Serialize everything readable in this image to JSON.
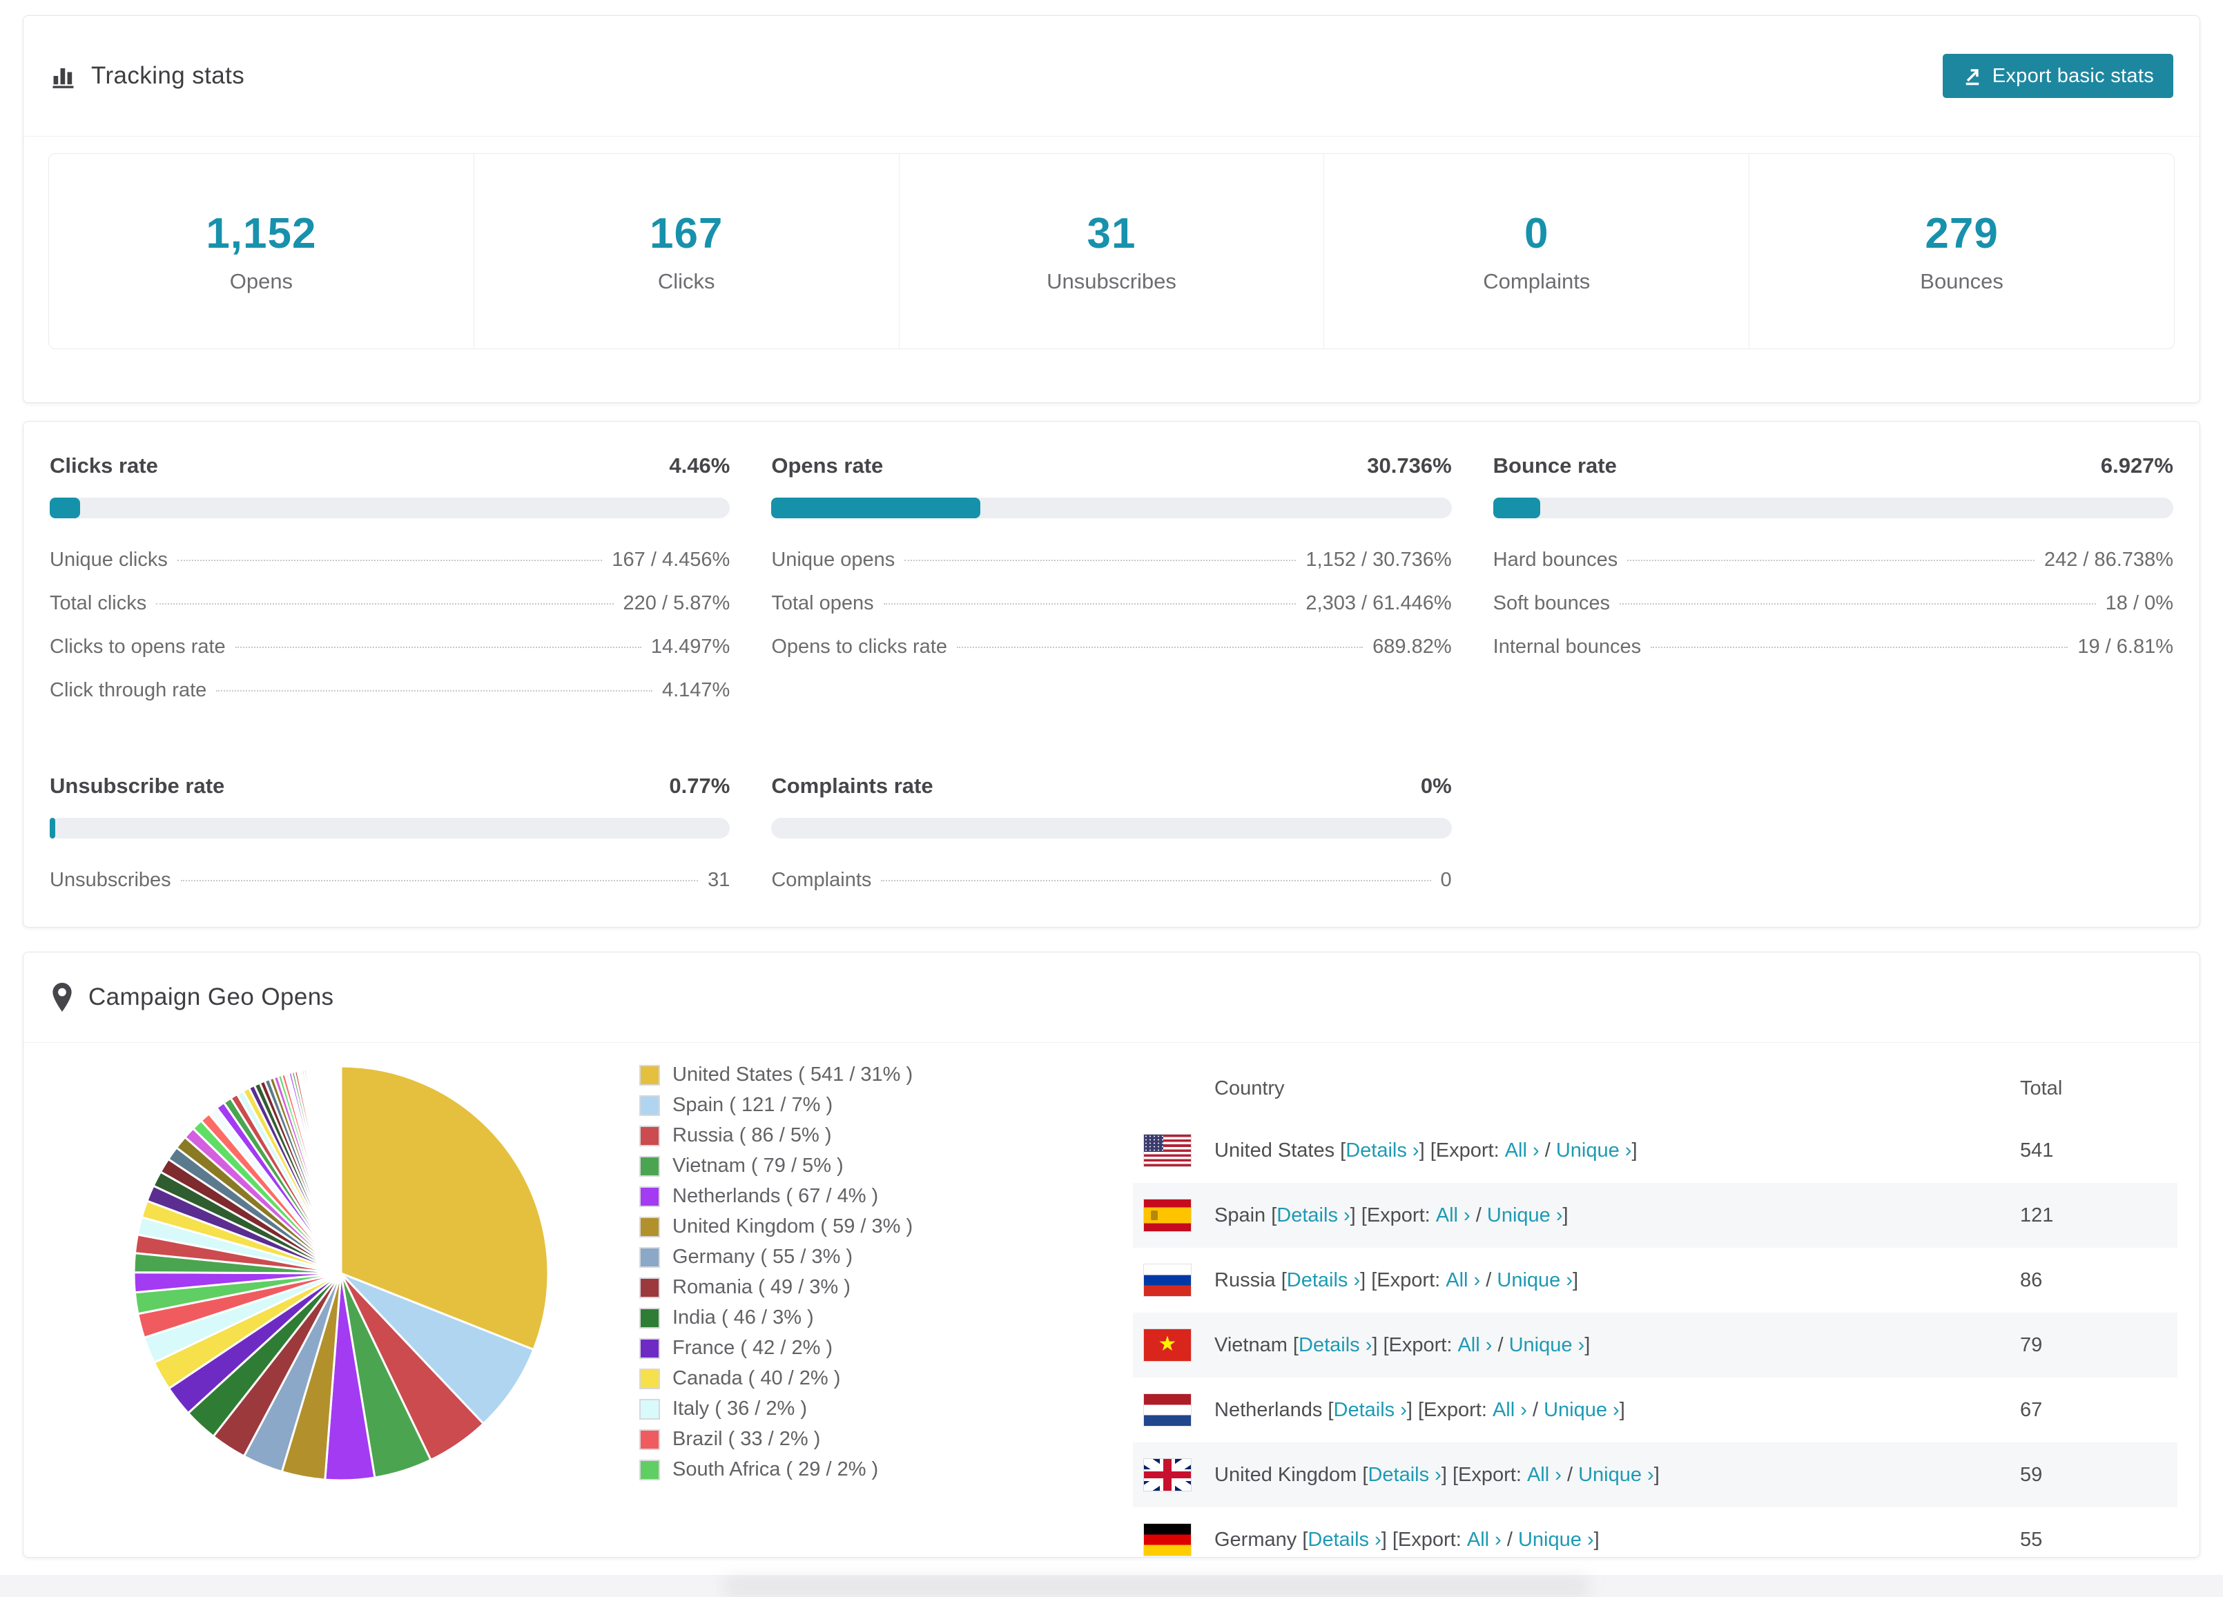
{
  "colors": {
    "accent_teal": "#1d87a0",
    "stat_teal": "#1791ac",
    "bar_fill": "#1592aa",
    "link_teal": "#1d9ab4",
    "bar_track": "#eceef2",
    "row_stripe": "#f6f7f8"
  },
  "tracking": {
    "title": "Tracking stats",
    "export_button": "Export basic stats",
    "stats": [
      {
        "value": "1,152",
        "label": "Opens"
      },
      {
        "value": "167",
        "label": "Clicks"
      },
      {
        "value": "31",
        "label": "Unsubscribes"
      },
      {
        "value": "0",
        "label": "Complaints"
      },
      {
        "value": "279",
        "label": "Bounces"
      }
    ]
  },
  "rates": [
    {
      "title": "Clicks rate",
      "percent": "4.46%",
      "bar_percent": 4.46,
      "rows": [
        {
          "label": "Unique clicks",
          "value": "167 / 4.456%"
        },
        {
          "label": "Total clicks",
          "value": "220 / 5.87%"
        },
        {
          "label": "Clicks to opens rate",
          "value": "14.497%"
        },
        {
          "label": "Click through rate",
          "value": "4.147%"
        }
      ]
    },
    {
      "title": "Opens rate",
      "percent": "30.736%",
      "bar_percent": 30.736,
      "rows": [
        {
          "label": "Unique opens",
          "value": "1,152 / 30.736%"
        },
        {
          "label": "Total opens",
          "value": "2,303 / 61.446%"
        },
        {
          "label": "Opens to clicks rate",
          "value": "689.82%"
        }
      ]
    },
    {
      "title": "Bounce rate",
      "percent": "6.927%",
      "bar_percent": 6.927,
      "rows": [
        {
          "label": "Hard bounces",
          "value": "242 / 86.738%"
        },
        {
          "label": "Soft bounces",
          "value": "18 / 0%"
        },
        {
          "label": "Internal bounces",
          "value": "19 / 6.81%"
        }
      ]
    },
    {
      "title": "Unsubscribe rate",
      "percent": "0.77%",
      "bar_percent": 0.77,
      "rows": [
        {
          "label": "Unsubscribes",
          "value": "31"
        }
      ]
    },
    {
      "title": "Complaints rate",
      "percent": "0%",
      "bar_percent": 0,
      "rows": [
        {
          "label": "Complaints",
          "value": "0"
        }
      ]
    }
  ],
  "geo": {
    "title": "Campaign Geo Opens",
    "links": {
      "open_bracket": " [",
      "details": "Details ›",
      "after_details": "] [Export: ",
      "all": "All ›",
      "slash": " / ",
      "unique": "Unique ›",
      "close_bracket": "]"
    },
    "table": {
      "columns": [
        "Country",
        "Total"
      ],
      "rows": [
        {
          "country": "United States",
          "flag": "us",
          "total": "541"
        },
        {
          "country": "Spain",
          "flag": "es",
          "total": "121"
        },
        {
          "country": "Russia",
          "flag": "ru",
          "total": "86"
        },
        {
          "country": "Vietnam",
          "flag": "vn",
          "total": "79"
        },
        {
          "country": "Netherlands",
          "flag": "nl",
          "total": "67"
        },
        {
          "country": "United Kingdom",
          "flag": "gb",
          "total": "59"
        },
        {
          "country": "Germany",
          "flag": "de",
          "total": "55"
        }
      ]
    }
  },
  "chart_data": {
    "type": "pie",
    "title": "Campaign Geo Opens",
    "unit": "opens",
    "start_angle_deg": -90,
    "direction": "clockwise",
    "legend_position": "right",
    "series": [
      {
        "name": "United States",
        "value": 541,
        "percent": "31%",
        "color": "#E5C03E",
        "legend_label": "United States ( 541 / 31% )"
      },
      {
        "name": "Spain",
        "value": 121,
        "percent": "7%",
        "color": "#AFD5F0",
        "legend_label": "Spain ( 121 / 7% )"
      },
      {
        "name": "Russia",
        "value": 86,
        "percent": "5%",
        "color": "#CB4B4F",
        "legend_label": "Russia ( 86 / 5% )"
      },
      {
        "name": "Vietnam",
        "value": 79,
        "percent": "5%",
        "color": "#4BA550",
        "legend_label": "Vietnam ( 79 / 5% )"
      },
      {
        "name": "Netherlands",
        "value": 67,
        "percent": "4%",
        "color": "#A23BF2",
        "legend_label": "Netherlands ( 67 / 4% )"
      },
      {
        "name": "United Kingdom",
        "value": 59,
        "percent": "3%",
        "color": "#B2912C",
        "legend_label": "United Kingdom ( 59 / 3% )"
      },
      {
        "name": "Germany",
        "value": 55,
        "percent": "3%",
        "color": "#8BA8C8",
        "legend_label": "Germany ( 55 / 3% )"
      },
      {
        "name": "Romania",
        "value": 49,
        "percent": "3%",
        "color": "#9C393D",
        "legend_label": "Romania ( 49 / 3% )"
      },
      {
        "name": "India",
        "value": 46,
        "percent": "3%",
        "color": "#2F7D35",
        "legend_label": "India ( 46 / 3% )"
      },
      {
        "name": "France",
        "value": 42,
        "percent": "2%",
        "color": "#6E2BC4",
        "legend_label": "France ( 42 / 2% )"
      },
      {
        "name": "Canada",
        "value": 40,
        "percent": "2%",
        "color": "#F6E04B",
        "legend_label": "Canada ( 40 / 2% )"
      },
      {
        "name": "Italy",
        "value": 36,
        "percent": "2%",
        "color": "#D8FAFA",
        "legend_label": "Italy ( 36 / 2% )"
      },
      {
        "name": "Brazil",
        "value": 33,
        "percent": "2%",
        "color": "#F05B5F",
        "legend_label": "Brazil ( 33 / 2% )"
      },
      {
        "name": "South Africa",
        "value": 29,
        "percent": "2%",
        "color": "#5FCE63",
        "legend_label": "South Africa ( 29 / 2% )"
      }
    ],
    "others": {
      "note": "remaining small countries, decreasing slice sizes",
      "values": [
        27,
        26,
        25,
        24,
        23,
        22,
        21,
        20,
        19,
        18,
        16,
        15,
        14,
        13,
        12,
        11,
        10,
        9,
        9,
        8,
        8,
        7,
        7,
        6,
        6,
        5,
        5,
        5,
        4,
        4,
        4,
        3,
        3,
        3,
        3,
        2,
        2,
        2,
        2,
        2,
        2,
        2,
        1,
        1,
        1,
        1,
        1,
        1,
        1,
        1,
        1,
        1,
        1,
        1,
        1,
        1,
        1,
        1,
        1,
        1,
        1,
        1,
        1,
        1,
        1,
        1,
        1,
        1,
        1,
        1,
        1,
        1,
        1,
        1,
        1
      ],
      "palette": [
        "#A23BF2",
        "#4BA550",
        "#CB4B4F",
        "#D8FAFA",
        "#F6E04B",
        "#5B2D91",
        "#2F5D2F",
        "#7E2A2E",
        "#5C7A8E",
        "#8A7A24",
        "#D45FE0",
        "#5FDE66",
        "#FC6B66",
        "#F4FBFF"
      ]
    }
  }
}
